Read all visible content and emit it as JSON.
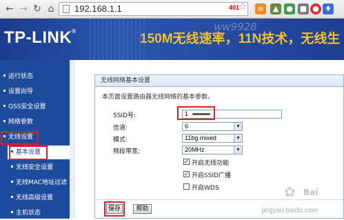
{
  "browser": {
    "url": "192.168.1.1",
    "badge": "401",
    "nav_icons": [
      "back-icon",
      "forward-icon",
      "reload-icon"
    ],
    "extension_icons": [
      "rss-icon",
      "rhino-icon",
      "apple-icon",
      "puzzle-icon",
      "record-icon",
      "square-icon",
      "pause-icon",
      "paw-icon"
    ]
  },
  "banner": {
    "logo": "TP-LINK",
    "slogan": "150M无线速率，11N技术，无线生",
    "watermark": "ww9928"
  },
  "sidebar": {
    "items": [
      {
        "label": "运行状态"
      },
      {
        "label": "设置向导"
      },
      {
        "label": "QSS安全设置"
      },
      {
        "label": "网络参数"
      },
      {
        "label": "无线设置"
      },
      {
        "label": "基本设置"
      },
      {
        "label": "无线安全设置"
      },
      {
        "label": "无线MAC地址过滤"
      },
      {
        "label": "无线高级设置"
      },
      {
        "label": "主机状态"
      }
    ]
  },
  "panel": {
    "title": "无线网络基本设置",
    "description": "本页面设置路由器无线网络的基本参数。",
    "fields": {
      "ssid_label": "SSID号:",
      "ssid_value": "1",
      "channel_label": "信道:",
      "channel_value": "6",
      "mode_label": "模式:",
      "mode_value": "11bg mixed",
      "bandwidth_label": "频段带宽:",
      "bandwidth_value": "20MHz"
    },
    "checkboxes": [
      {
        "label": "开启无线功能",
        "checked": true
      },
      {
        "label": "开启SSID广播",
        "checked": true
      },
      {
        "label": "开启WDS",
        "checked": false
      }
    ],
    "buttons": {
      "save": "保存",
      "help": "帮助"
    }
  },
  "watermark": {
    "brand": "Bai",
    "text": "jingyan.baidu.com"
  },
  "colors": {
    "sidebar_bg": "#1e4b9b",
    "highlight": "#e02020",
    "banner_accent": "#f0c030"
  }
}
